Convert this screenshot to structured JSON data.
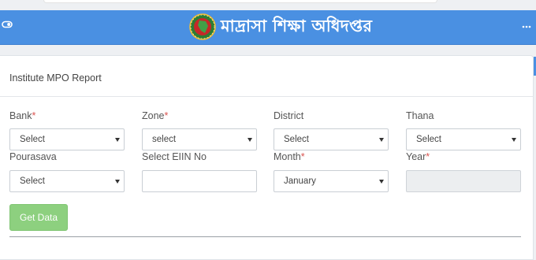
{
  "header": {
    "brand_title": "মাদ্রাসা শিক্ষা অধিদপ্তর",
    "background": "#4a90e2"
  },
  "page": {
    "title": "Institute MPO Report"
  },
  "form": {
    "bank": {
      "label": "Bank",
      "required": "*",
      "value": "Select"
    },
    "zone": {
      "label": "Zone",
      "required": "*",
      "value": "select"
    },
    "district": {
      "label": "District",
      "value": "Select"
    },
    "thana": {
      "label": "Thana",
      "value": "Select"
    },
    "pourasava": {
      "label": "Pourasava",
      "value": "Select"
    },
    "eiin": {
      "label": "Select EIIN No",
      "value": ""
    },
    "month": {
      "label": "Month",
      "required": "*",
      "value": "January"
    },
    "year": {
      "label": "Year",
      "required": "*",
      "value": ""
    },
    "submit_label": "Get Data"
  },
  "colors": {
    "accent": "#4a90e2",
    "button": "#8dd07f",
    "required": "#d9534f"
  }
}
